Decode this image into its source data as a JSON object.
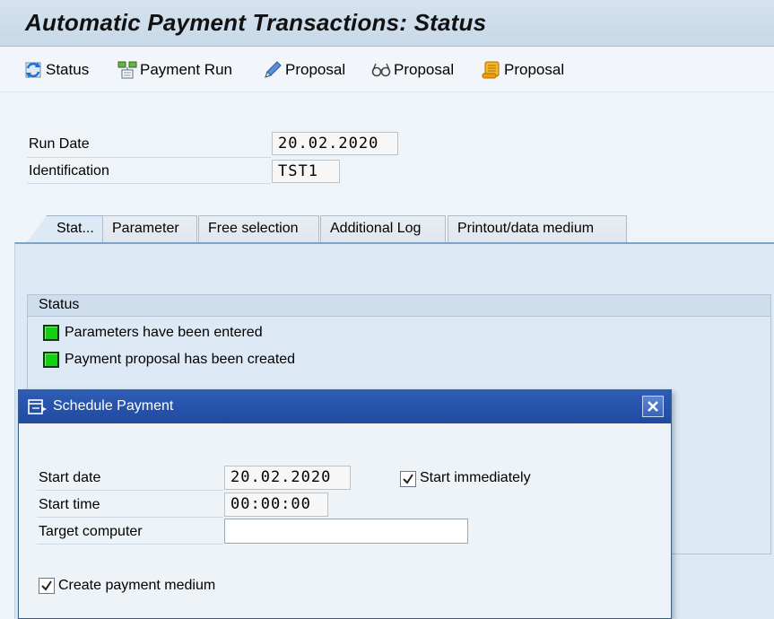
{
  "window": {
    "title": "Automatic Payment Transactions: Status"
  },
  "toolbar": {
    "items": [
      {
        "label": "Status",
        "icon": "refresh-status-icon"
      },
      {
        "label": "Payment Run",
        "icon": "payment-run-icon"
      },
      {
        "label": "Proposal",
        "icon": "pencil-edit-icon"
      },
      {
        "label": "Proposal",
        "icon": "glasses-display-icon"
      },
      {
        "label": "Proposal",
        "icon": "scroll-log-icon"
      }
    ]
  },
  "header_fields": {
    "run_date": {
      "label": "Run Date",
      "value": "20.02.2020"
    },
    "identification": {
      "label": "Identification",
      "value": "TST1"
    }
  },
  "tabs": [
    {
      "label": "Stat...",
      "active": true
    },
    {
      "label": "Parameter",
      "active": false
    },
    {
      "label": "Free selection",
      "active": false
    },
    {
      "label": "Additional Log",
      "active": false
    },
    {
      "label": "Printout/data medium",
      "active": false
    }
  ],
  "status_group": {
    "title": "Status",
    "items": [
      {
        "text": "Parameters have been entered",
        "state": "green"
      },
      {
        "text": "Payment proposal has been created",
        "state": "green"
      }
    ]
  },
  "dialog": {
    "title": "Schedule Payment",
    "start_date": {
      "label": "Start date",
      "value": "20.02.2020"
    },
    "start_time": {
      "label": "Start time",
      "value": "00:00:00"
    },
    "target_computer": {
      "label": "Target computer",
      "value": "",
      "placeholder": ""
    },
    "start_immediately": {
      "label": "Start immediately",
      "checked": true
    },
    "create_payment_medium": {
      "label": "Create payment medium",
      "checked": true
    }
  },
  "colors": {
    "title_bar": "#c7d8e8",
    "dialog_title": "#1f4aa0",
    "status_green": "#11d111",
    "tab_panel": "#dde9f5"
  }
}
